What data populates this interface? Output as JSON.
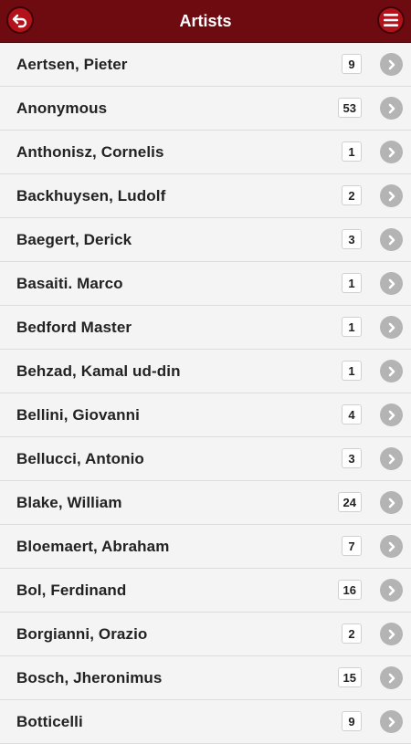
{
  "header": {
    "title": "Artists",
    "back_icon": "back-arrow-icon",
    "menu_icon": "hamburger-menu-icon",
    "accent_color": "#6e0b10"
  },
  "artists": [
    {
      "name": "Aertsen, Pieter",
      "count": "9"
    },
    {
      "name": "Anonymous",
      "count": "53"
    },
    {
      "name": "Anthonisz, Cornelis",
      "count": "1"
    },
    {
      "name": "Backhuysen, Ludolf",
      "count": "2"
    },
    {
      "name": "Baegert, Derick",
      "count": "3"
    },
    {
      "name": "Basaiti. Marco",
      "count": "1"
    },
    {
      "name": "Bedford Master",
      "count": "1"
    },
    {
      "name": "Behzad, Kamal ud-din",
      "count": "1"
    },
    {
      "name": "Bellini, Giovanni",
      "count": "4"
    },
    {
      "name": "Bellucci, Antonio",
      "count": "3"
    },
    {
      "name": "Blake, William",
      "count": "24"
    },
    {
      "name": "Bloemaert, Abraham",
      "count": "7"
    },
    {
      "name": "Bol, Ferdinand",
      "count": "16"
    },
    {
      "name": "Borgianni, Orazio",
      "count": "2"
    },
    {
      "name": "Bosch, Jheronimus",
      "count": "15"
    },
    {
      "name": "Botticelli",
      "count": "9"
    }
  ]
}
